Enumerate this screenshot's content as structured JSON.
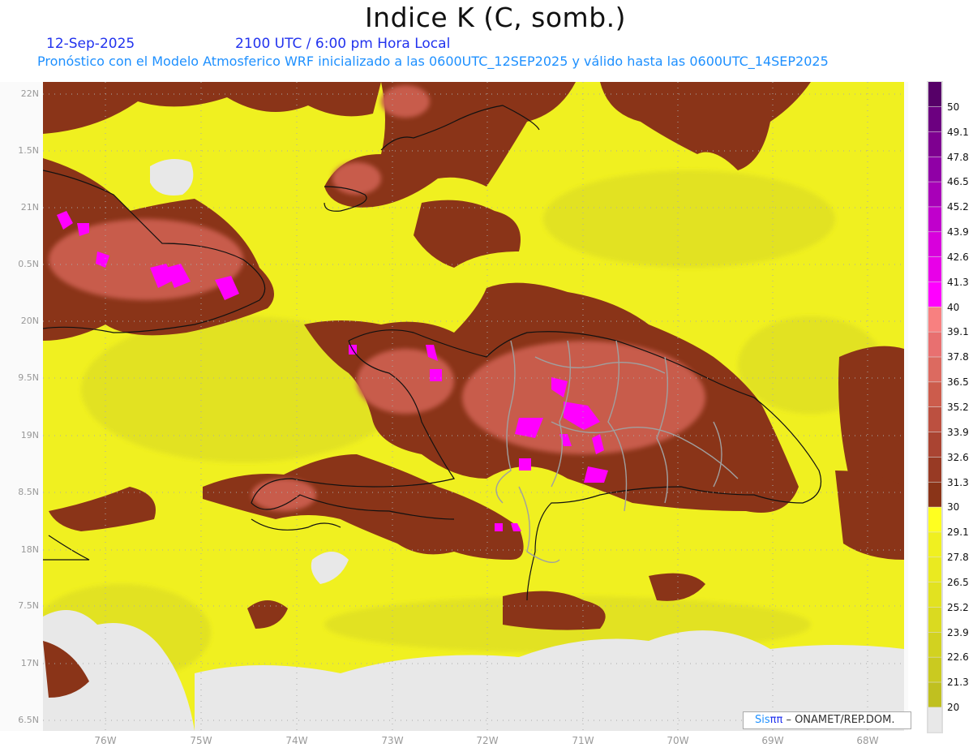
{
  "header": {
    "title": "Indice K (C, somb.)",
    "date": "12-Sep-2025",
    "time": "2100 UTC / 6:00 pm Hora Local",
    "subtitle": "Pronóstico con el Modelo Atmosferico WRF inicializado a las 0600UTC_12SEP2025 y válido hasta las  0600UTC_14SEP2025"
  },
  "map": {
    "lat_labels": [
      "22N",
      "1.5N",
      "21N",
      "0.5N",
      "20N",
      "9.5N",
      "19N",
      "8.5N",
      "18N",
      "7.5N",
      "17N",
      "6.5N"
    ],
    "lon_labels": [
      "76W",
      "75W",
      "74W",
      "73W",
      "72W",
      "71W",
      "70W",
      "69W",
      "68W"
    ]
  },
  "colorbar": {
    "labels": [
      "50",
      "49.1",
      "47.8",
      "46.5",
      "45.2",
      "43.9",
      "42.6",
      "41.3",
      "40",
      "39.1",
      "37.8",
      "36.5",
      "35.2",
      "33.9",
      "32.6",
      "31.3",
      "30",
      "29.1",
      "27.8",
      "26.5",
      "25.2",
      "23.9",
      "22.6",
      "21.3",
      "20"
    ],
    "colors_top_to_bottom": [
      "#560068",
      "#6c0080",
      "#7e0090",
      "#9000a6",
      "#a800b8",
      "#c000cc",
      "#d800dc",
      "#e800e8",
      "#ff00ff",
      "#f88080",
      "#e87070",
      "#dc6a60",
      "#cc5c4c",
      "#bc5040",
      "#aa4432",
      "#983a24",
      "#8a3418",
      "#ffff20",
      "#f0f020",
      "#eaea20",
      "#e2e220",
      "#dada20",
      "#d2d220",
      "#caca20",
      "#c0c020",
      "#e8e8e8"
    ]
  },
  "credit": {
    "logo_sis": "Sis",
    "logo_pi": "ππ",
    "text": "– ONAMET/REP.DOM."
  }
}
